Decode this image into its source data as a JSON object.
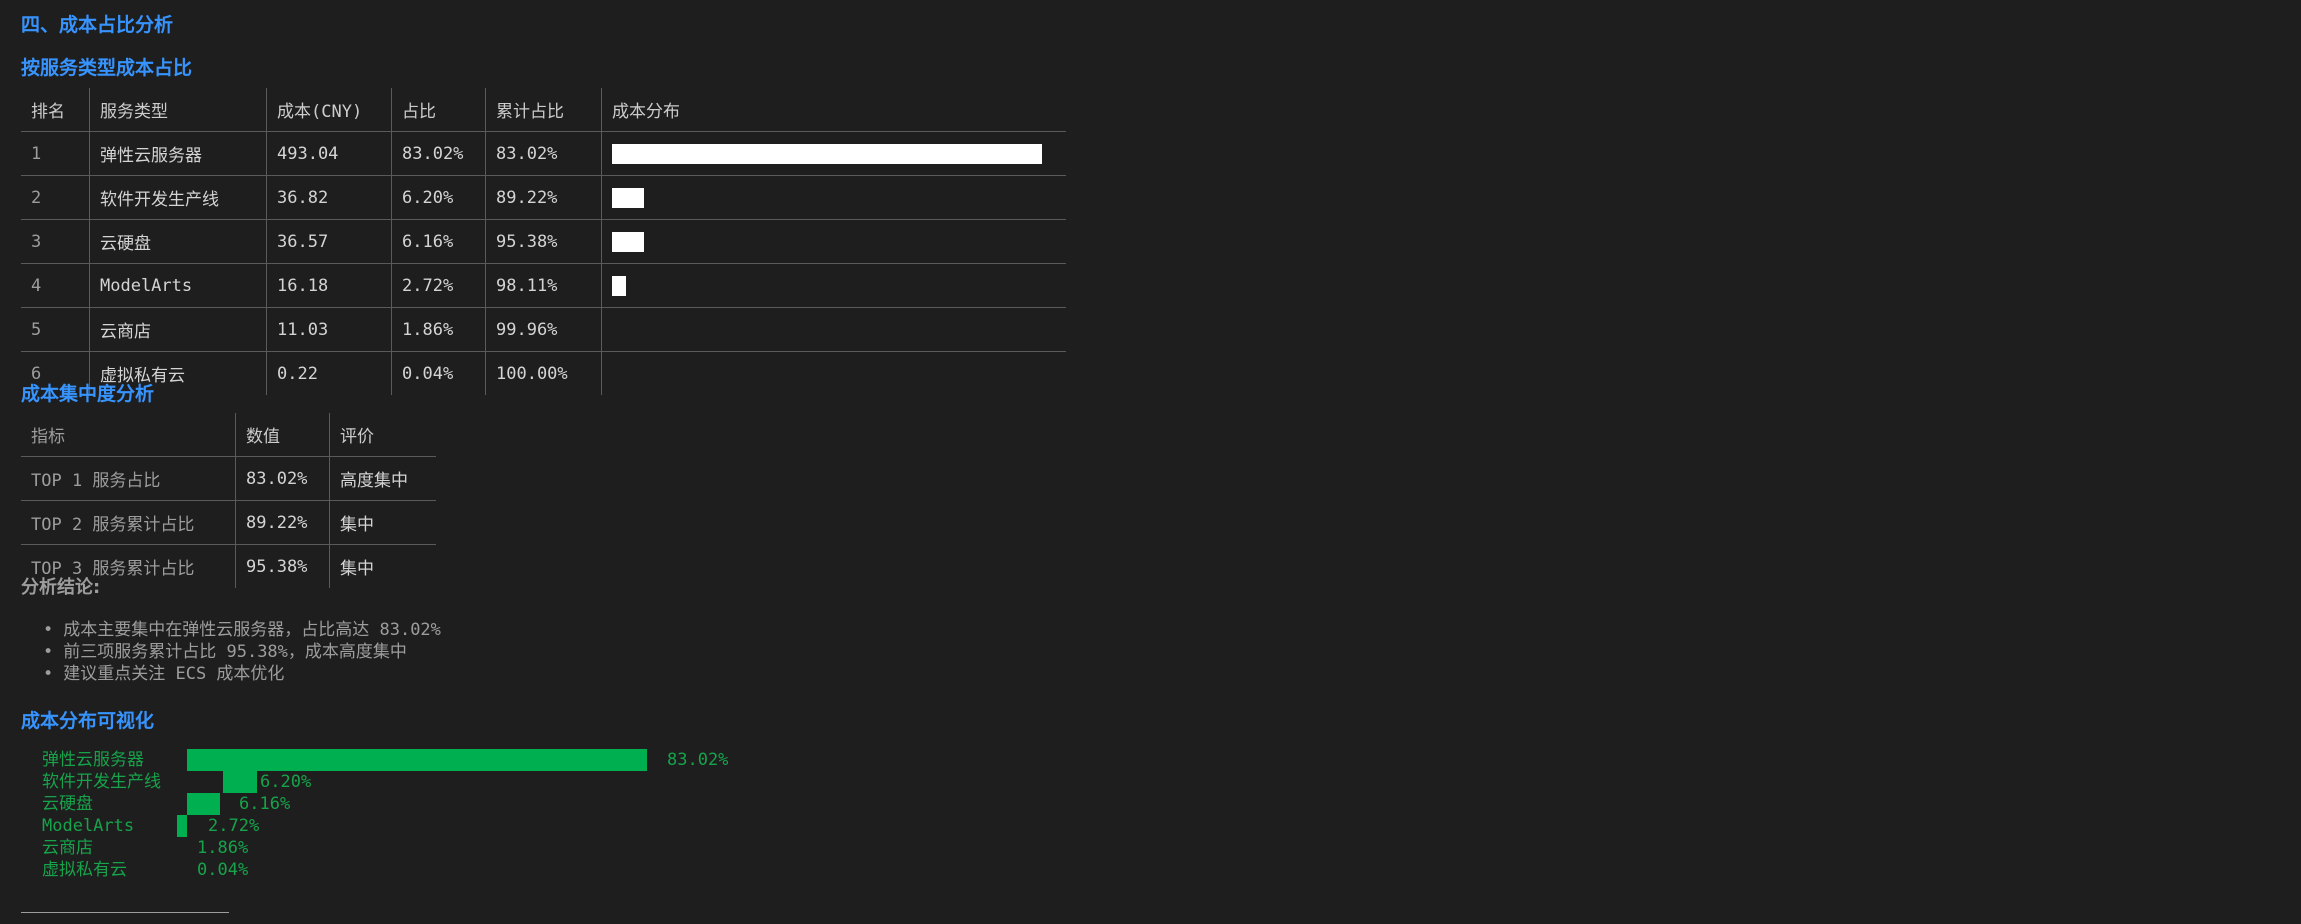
{
  "section_title": "四、成本占比分析",
  "service_table": {
    "title": "按服务类型成本占比",
    "headers": [
      "排名",
      "服务类型",
      "成本(CNY)",
      "占比",
      "累计占比",
      "成本分布"
    ],
    "rows": [
      {
        "rank": "1",
        "service": "弹性云服务器",
        "cost": "493.04",
        "share": "83.02%",
        "cumulative": "83.02%",
        "bar_fraction": 0.8302
      },
      {
        "rank": "2",
        "service": "软件开发生产线",
        "cost": "36.82",
        "share": "6.20%",
        "cumulative": "89.22%",
        "bar_fraction": 0.062
      },
      {
        "rank": "3",
        "service": "云硬盘",
        "cost": "36.57",
        "share": "6.16%",
        "cumulative": "95.38%",
        "bar_fraction": 0.0616
      },
      {
        "rank": "4",
        "service": "ModelArts",
        "cost": "16.18",
        "share": "2.72%",
        "cumulative": "98.11%",
        "bar_fraction": 0.0272
      },
      {
        "rank": "5",
        "service": "云商店",
        "cost": "11.03",
        "share": "1.86%",
        "cumulative": "99.96%",
        "bar_fraction": 0
      },
      {
        "rank": "6",
        "service": "虚拟私有云",
        "cost": "0.22",
        "share": "0.04%",
        "cumulative": "100.00%",
        "bar_fraction": 0
      }
    ]
  },
  "concentration_table": {
    "title": "成本集中度分析",
    "headers": [
      "指标",
      "数值",
      "评价"
    ],
    "rows": [
      {
        "metric": "TOP 1 服务占比",
        "value": "83.02%",
        "rating": "高度集中"
      },
      {
        "metric": "TOP 2 服务累计占比",
        "value": "89.22%",
        "rating": "集中"
      },
      {
        "metric": "TOP 3 服务累计占比",
        "value": "95.38%",
        "rating": "集中"
      }
    ]
  },
  "conclusion": {
    "label": "分析结论:",
    "items": [
      "成本主要集中在弹性云服务器，占比高达 83.02%",
      "前三项服务累计占比 95.38%，成本高度集中",
      "建议重点关注 ECS 成本优化"
    ]
  },
  "visualization": {
    "title": "成本分布可视化",
    "bar_color": "#00b050",
    "text_color": "#16a34a",
    "items": [
      {
        "label": "弹性云服务器",
        "pct_text": "83.02%",
        "fraction": 0.8302
      },
      {
        "label": "软件开发生产线",
        "pct_text": "6.20%",
        "fraction": 0.062
      },
      {
        "label": "云硬盘",
        "pct_text": "6.16%",
        "fraction": 0.0616
      },
      {
        "label": "ModelArts",
        "pct_text": "2.72%",
        "fraction": 0.0272
      },
      {
        "label": "云商店",
        "pct_text": "1.86%",
        "fraction": 0.0186
      },
      {
        "label": "虚拟私有云",
        "pct_text": "0.04%",
        "fraction": 0.0004
      }
    ]
  }
}
